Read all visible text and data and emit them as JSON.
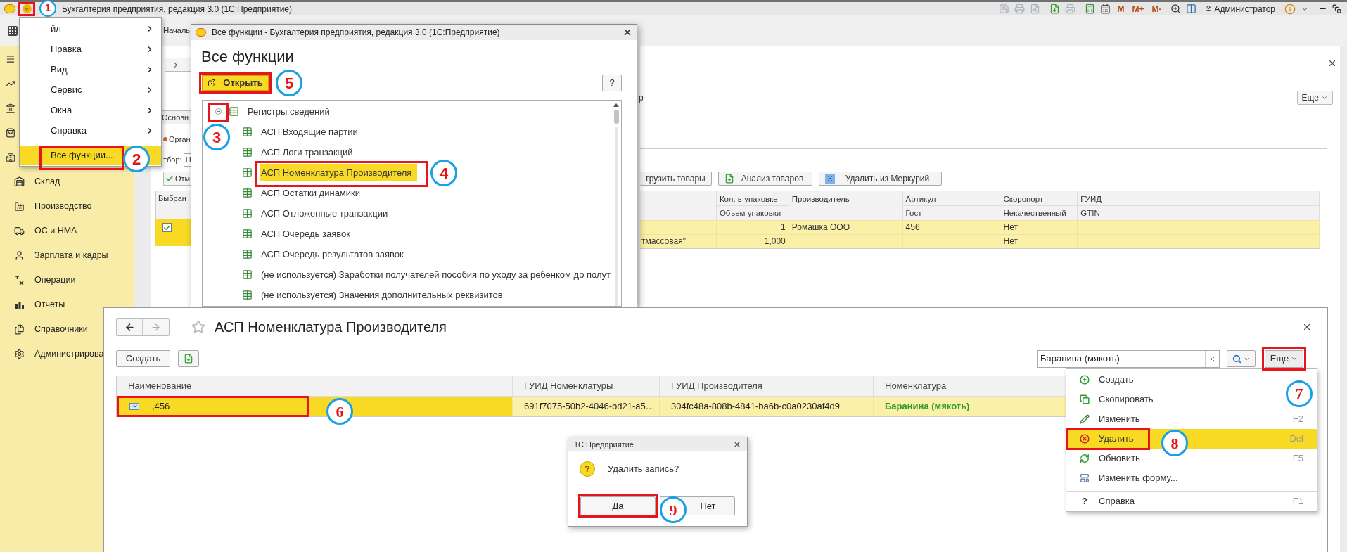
{
  "title_bar": {
    "menu_step": "1",
    "title": "Бухгалтерия предприятия, редакция 3.0  (1С:Предприятие)",
    "memory_buttons": [
      "M",
      "M+",
      "M-"
    ],
    "user": "Администратор"
  },
  "tab_bar": {
    "tab": "Началь"
  },
  "main_menu": [
    {
      "label": "йл",
      "kind": "submenu",
      "selected": false
    },
    {
      "label": "Правка",
      "kind": "submenu",
      "selected": false
    },
    {
      "label": "Вид",
      "kind": "submenu",
      "selected": false
    },
    {
      "label": "Сервис",
      "kind": "submenu",
      "selected": false
    },
    {
      "label": "Окна",
      "kind": "submenu",
      "selected": false
    },
    {
      "label": "Справка",
      "kind": "submenu",
      "selected": false
    },
    {
      "label": "Все функции...",
      "kind": "command",
      "selected": true,
      "step": "2"
    }
  ],
  "sidebar": {
    "items": [
      "Склад",
      "Производство",
      "ОС и НМА",
      "Зарплата и кадры",
      "Операции",
      "Отчеты",
      "Справочники",
      "Администрирова"
    ]
  },
  "background_form": {
    "tab": "Основн",
    "organization": "Орган",
    "filter_label": "тбор:",
    "filter_value": "Н",
    "mark_button": "Отм",
    "left_column": "Выбран",
    "left_rows": [
      {
        "checked": true
      }
    ],
    "label_fragment": "р",
    "more_button": "Еще",
    "buttons": [
      "грузить товары",
      "Анализ товаров",
      "Удалить из Меркурий"
    ],
    "table": {
      "columns": [
        {
          "top": "Кол. в упаковке",
          "bottom": "Объем упаковки"
        },
        {
          "top": "Производитель"
        },
        {
          "top": "Артикул",
          "bottom": "Гост"
        },
        {
          "top": "Скоропорт",
          "bottom": "Некачественный"
        },
        {
          "top": "ГУИД",
          "bottom": "GTIN"
        }
      ],
      "rows": [
        {
          "column_2": "1",
          "column_3": "Ромашка ООО",
          "column_4": "456",
          "column_5": "Нет"
        },
        {
          "column_1": "тмассовая\"",
          "column_2": "1,000",
          "column_5": "Нет"
        }
      ]
    }
  },
  "all_functions": {
    "title": "Все функции - Бухгалтерия предприятия, редакция 3.0  (1С:Предприятие)",
    "heading": "Все функции",
    "open_button": {
      "label": "Открыть",
      "step": "5"
    },
    "help_button": "?",
    "tree": [
      {
        "label": "Регистры сведений",
        "expanded": true,
        "toggle_step": "3",
        "children": [
          {
            "label": "АСП Входящие партии",
            "selected": false
          },
          {
            "label": "АСП Логи транзакций",
            "selected": false
          },
          {
            "label": "АСП Номенклатура Производителя",
            "selected": true,
            "step": "4"
          },
          {
            "label": "АСП Остатки динамики",
            "selected": false
          },
          {
            "label": "АСП Отложенные транзакции",
            "selected": false
          },
          {
            "label": "АСП Очередь заявок",
            "selected": false
          },
          {
            "label": "АСП Очередь результатов заявок",
            "selected": false
          },
          {
            "label": "(не используется) Заработки получателей пособия по уходу за ребенком до полут",
            "selected": false
          },
          {
            "label": "(не используется) Значения дополнительных реквизитов",
            "selected": false
          }
        ]
      }
    ]
  },
  "catalog_window": {
    "title": "АСП Номенклатура Производителя",
    "create_button": "Создать",
    "search": {
      "value": "Баранина (мякоть)"
    },
    "more_button": {
      "label": "Еще",
      "step": "7"
    },
    "table": {
      "columns": [
        "Наименование",
        "ГУИД Номенклатуры",
        "ГУИД Производителя",
        "Номенклатура"
      ],
      "rows": [
        {
          "selected": true,
          "step": "6",
          "cells": [
            ",456",
            "691f7075-50b2-4046-bd21-a5…",
            "304fc48a-808b-4841-ba6b-c0a0230af4d9",
            "Баранина (мякоть)"
          ]
        }
      ]
    },
    "more_menu": [
      {
        "label": "Создать",
        "selected": false,
        "separator_before": false
      },
      {
        "label": "Скопировать",
        "selected": false,
        "separator_before": false
      },
      {
        "label": "Изменить",
        "shortcut": "F2",
        "selected": false,
        "separator_before": false
      },
      {
        "label": "Удалить",
        "shortcut": "Del",
        "selected": true,
        "separator_before": false,
        "step": "8"
      },
      {
        "label": "Обновить",
        "shortcut": "F5",
        "selected": false,
        "separator_before": false
      },
      {
        "label": "Изменить форму...",
        "selected": false,
        "separator_before": false
      },
      {
        "label": "Справка",
        "shortcut": "F1",
        "glyph": "?",
        "selected": false,
        "separator_before": true
      }
    ],
    "confirm_dialog": {
      "title": "1С:Предприятие",
      "icon_glyph": "?",
      "message": "Удалить запись?",
      "buttons": [
        {
          "label": "Да",
          "step": "9"
        },
        {
          "label": "Нет"
        }
      ]
    }
  }
}
